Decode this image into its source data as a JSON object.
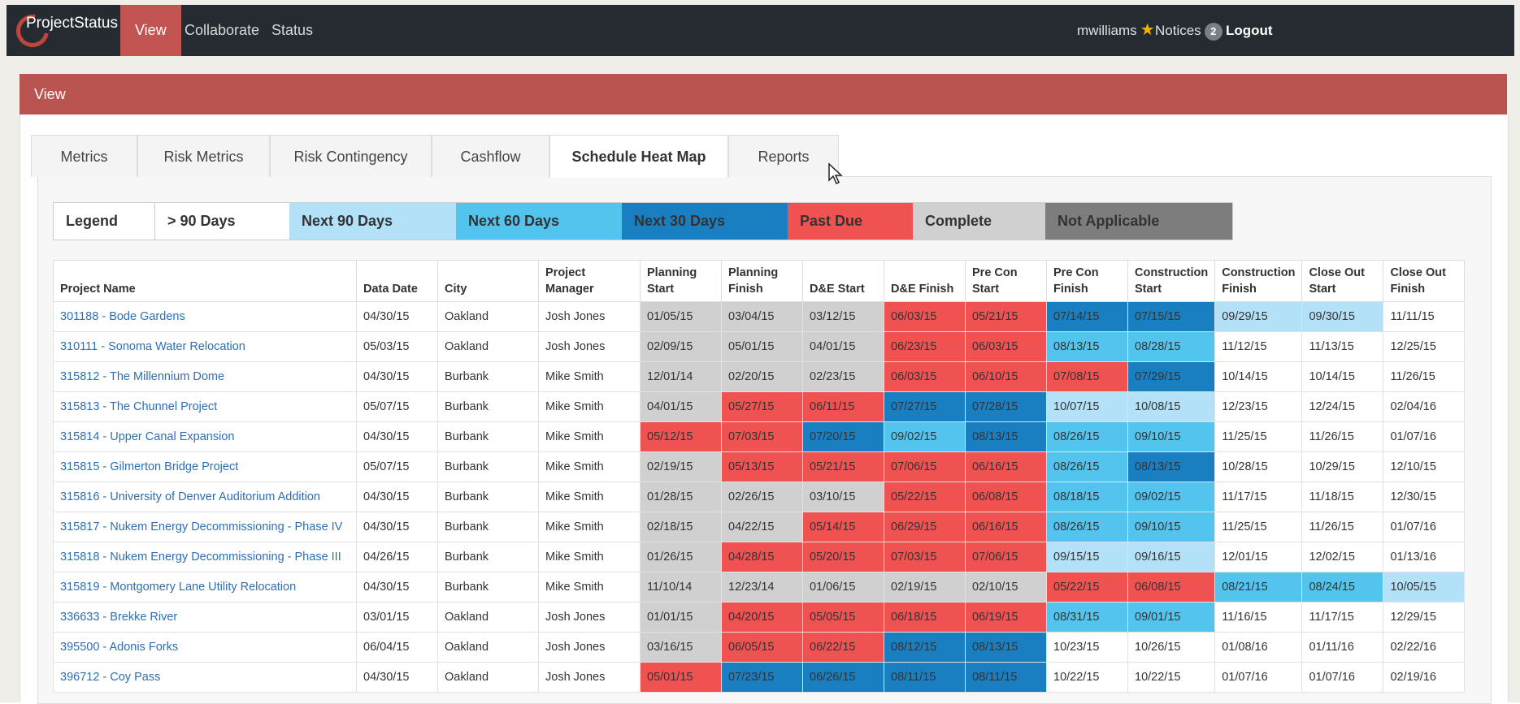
{
  "app": {
    "brand": "ProjectStatus",
    "nav": [
      "View",
      "Collaborate",
      "Status"
    ],
    "user": "mwilliams",
    "notices_label": "Notices",
    "notices_count": "2",
    "logout": "Logout"
  },
  "view_bar": {
    "title": "View"
  },
  "tabs": [
    "Metrics",
    "Risk Metrics",
    "Risk Contingency",
    "Cashflow",
    "Schedule Heat Map",
    "Reports"
  ],
  "active_tab": "Schedule Heat Map",
  "legend": {
    "title": "Legend",
    "items": [
      {
        "label": "> 90 Days",
        "color": "#ffffff"
      },
      {
        "label": "Next 90 Days",
        "color": "#b3e1f7"
      },
      {
        "label": "Next 60 Days",
        "color": "#52c4ee"
      },
      {
        "label": "Next 30 Days",
        "color": "#1a7fc1"
      },
      {
        "label": "Past Due",
        "color": "#f05252"
      },
      {
        "label": "Complete",
        "color": "#d0d0d0"
      },
      {
        "label": "Not Applicable",
        "color": "#7d7d7d"
      }
    ]
  },
  "table": {
    "headers": [
      "Project Name",
      "Data Date",
      "City",
      "Project Manager",
      "Planning Start",
      "Planning Finish",
      "D&E Start",
      "D&E Finish",
      "Pre Con Start",
      "Pre Con Finish",
      "Construction Start",
      "Construction Finish",
      "Close Out Start",
      "Close Out Finish"
    ],
    "rows": [
      {
        "name": "301188 - Bode Gardens",
        "date": "04/30/15",
        "city": "Oakland",
        "pm": "Josh Jones",
        "cells": [
          [
            "01/05/15",
            "complete"
          ],
          [
            "03/04/15",
            "complete"
          ],
          [
            "03/12/15",
            "complete"
          ],
          [
            "06/03/15",
            "past"
          ],
          [
            "05/21/15",
            "past"
          ],
          [
            "07/14/15",
            "d30"
          ],
          [
            "07/15/15",
            "d30"
          ],
          [
            "09/29/15",
            "d90"
          ],
          [
            "09/30/15",
            "d90"
          ],
          [
            "11/11/15",
            "none"
          ]
        ]
      },
      {
        "name": "310111 - Sonoma Water Relocation",
        "date": "05/03/15",
        "city": "Oakland",
        "pm": "Josh Jones",
        "cells": [
          [
            "02/09/15",
            "complete"
          ],
          [
            "05/01/15",
            "complete"
          ],
          [
            "04/01/15",
            "complete"
          ],
          [
            "06/23/15",
            "past"
          ],
          [
            "06/03/15",
            "past"
          ],
          [
            "08/13/15",
            "d60"
          ],
          [
            "08/28/15",
            "d60"
          ],
          [
            "11/12/15",
            "none"
          ],
          [
            "11/13/15",
            "none"
          ],
          [
            "12/25/15",
            "none"
          ]
        ]
      },
      {
        "name": "315812 - The Millennium Dome",
        "date": "04/30/15",
        "city": "Burbank",
        "pm": "Mike Smith",
        "cells": [
          [
            "12/01/14",
            "complete"
          ],
          [
            "02/20/15",
            "complete"
          ],
          [
            "02/23/15",
            "complete"
          ],
          [
            "06/03/15",
            "past"
          ],
          [
            "06/10/15",
            "past"
          ],
          [
            "07/08/15",
            "past"
          ],
          [
            "07/29/15",
            "d30"
          ],
          [
            "10/14/15",
            "none"
          ],
          [
            "10/14/15",
            "none"
          ],
          [
            "11/26/15",
            "none"
          ]
        ]
      },
      {
        "name": "315813 - The Chunnel Project",
        "date": "05/07/15",
        "city": "Burbank",
        "pm": "Mike Smith",
        "cells": [
          [
            "04/01/15",
            "complete"
          ],
          [
            "05/27/15",
            "past"
          ],
          [
            "06/11/15",
            "past"
          ],
          [
            "07/27/15",
            "d30"
          ],
          [
            "07/28/15",
            "d30"
          ],
          [
            "10/07/15",
            "d90"
          ],
          [
            "10/08/15",
            "d90"
          ],
          [
            "12/23/15",
            "none"
          ],
          [
            "12/24/15",
            "none"
          ],
          [
            "02/04/16",
            "none"
          ]
        ]
      },
      {
        "name": "315814 - Upper Canal Expansion",
        "date": "04/30/15",
        "city": "Burbank",
        "pm": "Mike Smith",
        "cells": [
          [
            "05/12/15",
            "past"
          ],
          [
            "07/03/15",
            "past"
          ],
          [
            "07/20/15",
            "d30"
          ],
          [
            "09/02/15",
            "d60"
          ],
          [
            "08/13/15",
            "d30"
          ],
          [
            "08/26/15",
            "d60"
          ],
          [
            "09/10/15",
            "d60"
          ],
          [
            "11/25/15",
            "none"
          ],
          [
            "11/26/15",
            "none"
          ],
          [
            "01/07/16",
            "none"
          ]
        ]
      },
      {
        "name": "315815 - Gilmerton Bridge Project",
        "date": "05/07/15",
        "city": "Burbank",
        "pm": "Mike Smith",
        "cells": [
          [
            "02/19/15",
            "complete"
          ],
          [
            "05/13/15",
            "past"
          ],
          [
            "05/21/15",
            "past"
          ],
          [
            "07/06/15",
            "past"
          ],
          [
            "06/16/15",
            "past"
          ],
          [
            "08/26/15",
            "d60"
          ],
          [
            "08/13/15",
            "d30"
          ],
          [
            "10/28/15",
            "none"
          ],
          [
            "10/29/15",
            "none"
          ],
          [
            "12/10/15",
            "none"
          ]
        ]
      },
      {
        "name": "315816 - University of Denver Auditorium Addition",
        "date": "04/30/15",
        "city": "Burbank",
        "pm": "Mike Smith",
        "cells": [
          [
            "01/28/15",
            "complete"
          ],
          [
            "02/26/15",
            "complete"
          ],
          [
            "03/10/15",
            "complete"
          ],
          [
            "05/22/15",
            "past"
          ],
          [
            "06/08/15",
            "past"
          ],
          [
            "08/18/15",
            "d60"
          ],
          [
            "09/02/15",
            "d60"
          ],
          [
            "11/17/15",
            "none"
          ],
          [
            "11/18/15",
            "none"
          ],
          [
            "12/30/15",
            "none"
          ]
        ]
      },
      {
        "name": "315817 - Nukem Energy Decommissioning - Phase IV",
        "date": "04/30/15",
        "city": "Burbank",
        "pm": "Mike Smith",
        "cells": [
          [
            "02/18/15",
            "complete"
          ],
          [
            "04/22/15",
            "complete"
          ],
          [
            "05/14/15",
            "past"
          ],
          [
            "06/29/15",
            "past"
          ],
          [
            "06/16/15",
            "past"
          ],
          [
            "08/26/15",
            "d60"
          ],
          [
            "09/10/15",
            "d60"
          ],
          [
            "11/25/15",
            "none"
          ],
          [
            "11/26/15",
            "none"
          ],
          [
            "01/07/16",
            "none"
          ]
        ]
      },
      {
        "name": "315818 - Nukem Energy Decommissioning - Phase III",
        "date": "04/26/15",
        "city": "Burbank",
        "pm": "Mike Smith",
        "cells": [
          [
            "01/26/15",
            "complete"
          ],
          [
            "04/28/15",
            "past"
          ],
          [
            "05/20/15",
            "past"
          ],
          [
            "07/03/15",
            "past"
          ],
          [
            "07/06/15",
            "past"
          ],
          [
            "09/15/15",
            "d90"
          ],
          [
            "09/16/15",
            "d90"
          ],
          [
            "12/01/15",
            "none"
          ],
          [
            "12/02/15",
            "none"
          ],
          [
            "01/13/16",
            "none"
          ]
        ]
      },
      {
        "name": "315819 - Montgomery Lane Utility Relocation",
        "date": "04/30/15",
        "city": "Burbank",
        "pm": "Mike Smith",
        "cells": [
          [
            "11/10/14",
            "complete"
          ],
          [
            "12/23/14",
            "complete"
          ],
          [
            "01/06/15",
            "complete"
          ],
          [
            "02/19/15",
            "complete"
          ],
          [
            "02/10/15",
            "complete"
          ],
          [
            "05/22/15",
            "past"
          ],
          [
            "06/08/15",
            "past"
          ],
          [
            "08/21/15",
            "d60"
          ],
          [
            "08/24/15",
            "d60"
          ],
          [
            "10/05/15",
            "d90"
          ]
        ]
      },
      {
        "name": "336633 - Brekke River",
        "date": "03/01/15",
        "city": "Oakland",
        "pm": "Josh Jones",
        "cells": [
          [
            "01/01/15",
            "complete"
          ],
          [
            "04/20/15",
            "past"
          ],
          [
            "05/05/15",
            "past"
          ],
          [
            "06/18/15",
            "past"
          ],
          [
            "06/19/15",
            "past"
          ],
          [
            "08/31/15",
            "d60"
          ],
          [
            "09/01/15",
            "d60"
          ],
          [
            "11/16/15",
            "none"
          ],
          [
            "11/17/15",
            "none"
          ],
          [
            "12/29/15",
            "none"
          ]
        ]
      },
      {
        "name": "395500 - Adonis Forks",
        "date": "06/04/15",
        "city": "Oakland",
        "pm": "Josh Jones",
        "cells": [
          [
            "03/16/15",
            "complete"
          ],
          [
            "06/05/15",
            "past"
          ],
          [
            "06/22/15",
            "past"
          ],
          [
            "08/12/15",
            "d30"
          ],
          [
            "08/13/15",
            "d30"
          ],
          [
            "10/23/15",
            "none"
          ],
          [
            "10/26/15",
            "none"
          ],
          [
            "01/08/16",
            "none"
          ],
          [
            "01/11/16",
            "none"
          ],
          [
            "02/22/16",
            "none"
          ]
        ]
      },
      {
        "name": "396712 - Coy Pass",
        "date": "04/30/15",
        "city": "Oakland",
        "pm": "Josh Jones",
        "cells": [
          [
            "05/01/15",
            "past"
          ],
          [
            "07/23/15",
            "d30"
          ],
          [
            "06/26/15",
            "d30"
          ],
          [
            "08/11/15",
            "d30"
          ],
          [
            "08/11/15",
            "d30"
          ],
          [
            "10/22/15",
            "none"
          ],
          [
            "10/22/15",
            "none"
          ],
          [
            "01/07/16",
            "none"
          ],
          [
            "01/07/16",
            "none"
          ],
          [
            "02/19/16",
            "none"
          ]
        ]
      }
    ]
  }
}
